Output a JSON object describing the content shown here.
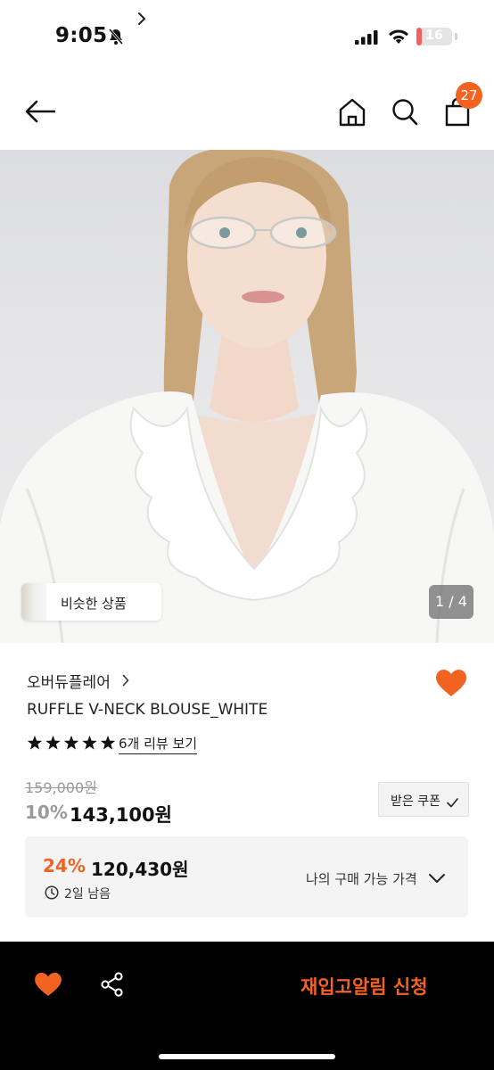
{
  "status_bar": {
    "time": "9:05",
    "battery": "16",
    "battery_level_percent": 16
  },
  "nav": {
    "cart_count": "27"
  },
  "hero": {
    "similar_label": "비슷한 상품",
    "pager": "1 / 4"
  },
  "product": {
    "brand": "오버듀플레어",
    "title": "RUFFLE V-NECK BLOUSE_WHITE",
    "rating_stars": 5,
    "review_link": "6개 리뷰 보기",
    "original_price": "159,000원",
    "discount": "10%",
    "sale_price": "143,100원",
    "coupon_button": "받은 쿠폰"
  },
  "best_price": {
    "percent": "24%",
    "price": "120,430원",
    "time_left": "2일 남음",
    "label": "나의 구매 가능 가격"
  },
  "bottom_bar": {
    "restock": "재입고알림 신청"
  },
  "colors": {
    "accent": "#f26322",
    "bar": "#000000"
  }
}
